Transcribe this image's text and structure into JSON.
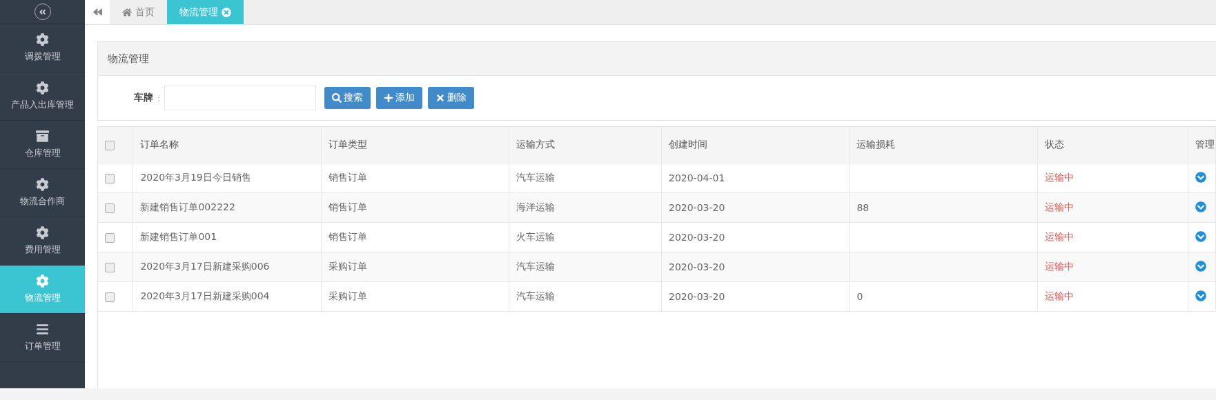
{
  "sidebar": {
    "items": [
      {
        "label": "调拨管理",
        "kind": "gear",
        "selected": false
      },
      {
        "label": "产品入出库管理",
        "kind": "gear",
        "selected": false
      },
      {
        "label": "仓库管理",
        "kind": "archive",
        "selected": false
      },
      {
        "label": "物流合作商",
        "kind": "gear",
        "selected": false
      },
      {
        "label": "费用管理",
        "kind": "gear",
        "selected": false
      },
      {
        "label": "物流管理",
        "kind": "gear",
        "selected": true
      },
      {
        "label": "订单管理",
        "kind": "bars",
        "selected": false
      }
    ]
  },
  "tabs": [
    {
      "label": "首页",
      "kind": "home",
      "selected": false
    },
    {
      "label": "物流管理",
      "kind": "closable",
      "selected": true
    }
  ],
  "panel": {
    "title": "物流管理",
    "search_label": "车牌",
    "search_separator": ":",
    "buttons": [
      {
        "label": "搜索",
        "kind": "search"
      },
      {
        "label": "添加",
        "kind": "plus"
      },
      {
        "label": "删除",
        "kind": "times"
      }
    ]
  },
  "table": {
    "header_checked": false,
    "columns": [
      "订单名称",
      "订单类型",
      "运输方式",
      "创建时间",
      "运输损耗",
      "状态",
      "管理"
    ],
    "rows": [
      {
        "checked": false,
        "cells": [
          "2020年3月19日今日销售",
          "销售订单",
          "汽车运输",
          "2020-04-01",
          "",
          "运输中"
        ]
      },
      {
        "checked": false,
        "cells": [
          "新建销售订单002222",
          "销售订单",
          "海洋运输",
          "2020-03-20",
          "88",
          "运输中"
        ]
      },
      {
        "checked": false,
        "cells": [
          "新建销售订单001",
          "销售订单",
          "火车运输",
          "2020-03-20",
          "",
          "运输中"
        ]
      },
      {
        "checked": false,
        "cells": [
          "2020年3月17日新建采购006",
          "采购订单",
          "汽车运输",
          "2020-03-20",
          "",
          "运输中"
        ]
      },
      {
        "checked": false,
        "cells": [
          "2020年3月17日新建采购004",
          "采购订单",
          "汽车运输",
          "2020-03-20",
          "0",
          "运输中"
        ]
      }
    ]
  }
}
